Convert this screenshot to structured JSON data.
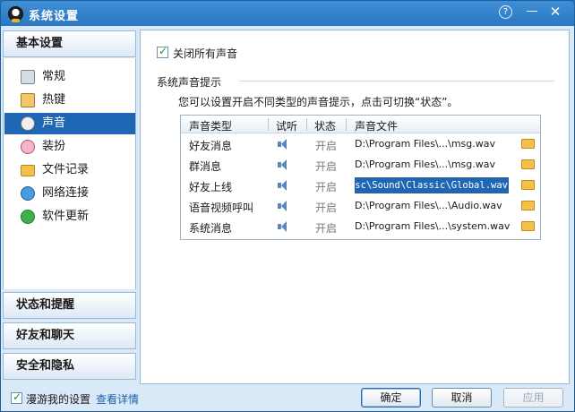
{
  "window": {
    "title": "系统设置"
  },
  "titlebar": {
    "help": "?",
    "minimize": "—",
    "close": "✕"
  },
  "sidebar": {
    "sections": [
      "基本设置",
      "状态和提醒",
      "好友和聊天",
      "安全和隐私"
    ],
    "items": [
      {
        "label": "常规",
        "icon": "general-icon"
      },
      {
        "label": "热键",
        "icon": "hotkey-icon"
      },
      {
        "label": "声音",
        "icon": "sound-icon",
        "active": true
      },
      {
        "label": "装扮",
        "icon": "dress-icon"
      },
      {
        "label": "文件记录",
        "icon": "folder-icon"
      },
      {
        "label": "网络连接",
        "icon": "network-icon"
      },
      {
        "label": "软件更新",
        "icon": "update-icon"
      }
    ]
  },
  "main": {
    "mute_all_label": "关闭所有声音",
    "mute_all_checked": true,
    "section_title": "系统声音提示",
    "hint": "您可以设置开启不同类型的声音提示，点击可切换“状态”。",
    "columns": [
      "声音类型",
      "试听",
      "状态",
      "声音文件"
    ],
    "rows": [
      {
        "type": "好友消息",
        "state": "开启",
        "file": "D:\\Program Files\\...\\msg.wav"
      },
      {
        "type": "群消息",
        "state": "开启",
        "file": "D:\\Program Files\\...\\msg.wav"
      },
      {
        "type": "好友上线",
        "state": "开启",
        "file": "isc\\Sound\\Classic\\Global.wav",
        "editing": true
      },
      {
        "type": "语音视频呼叫",
        "state": "开启",
        "file": "D:\\Program Files\\...\\Audio.wav"
      },
      {
        "type": "系统消息",
        "state": "开启",
        "file": "D:\\Program Files\\...\\system.wav"
      }
    ]
  },
  "footer": {
    "roam_label": "漫游我的设置",
    "roam_checked": true,
    "detail_link": "查看详情",
    "ok": "确定",
    "cancel": "取消",
    "apply": "应用"
  },
  "colors": {
    "titlebar": "#2a76c2",
    "selection": "#1f66b5",
    "link": "#1b61b0"
  }
}
